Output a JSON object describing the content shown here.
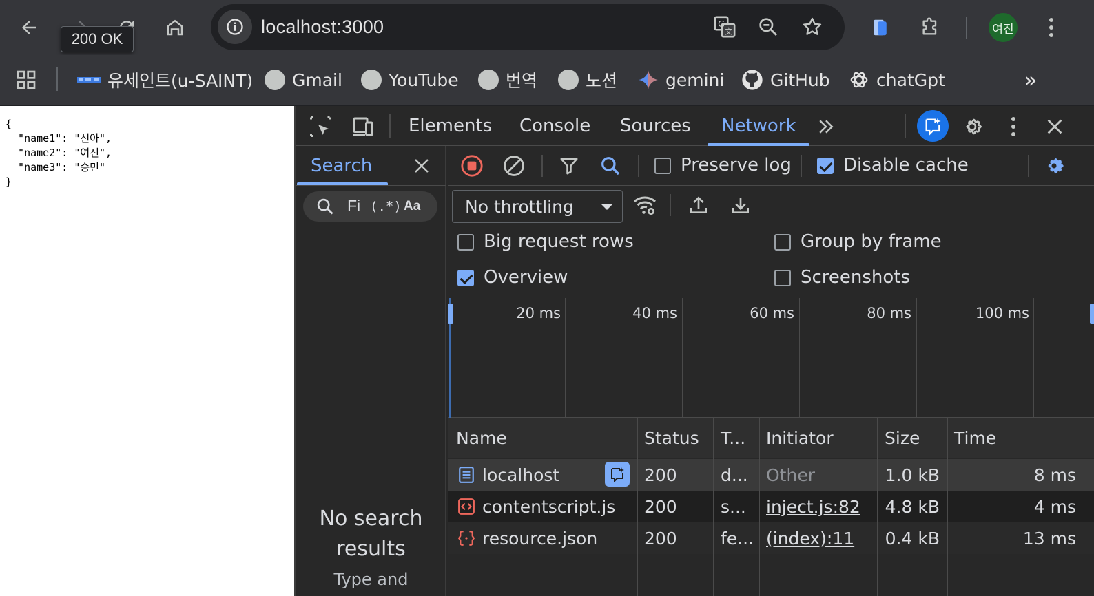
{
  "browser": {
    "url": "localhost:3000",
    "tooltip": "200 OK",
    "avatar_text": "여진",
    "icons": [
      "back-icon",
      "forward-icon",
      "reload-icon",
      "home-icon",
      "site-info-icon",
      "translate-icon",
      "zoom-icon",
      "bookmark-star-icon",
      "extension-icon",
      "puzzle-icon",
      "menu-icon"
    ]
  },
  "bookmarks": {
    "items": [
      {
        "label": "유세인트(u-SAINT)",
        "icon": "usaint-icon"
      },
      {
        "label": "Gmail",
        "icon": "globe-icon"
      },
      {
        "label": "YouTube",
        "icon": "globe-icon"
      },
      {
        "label": "번역",
        "icon": "globe-icon"
      },
      {
        "label": "노션",
        "icon": "globe-icon"
      },
      {
        "label": "gemini",
        "icon": "gemini-icon"
      },
      {
        "label": "GitHub",
        "icon": "github-icon"
      },
      {
        "label": "chatGpt",
        "icon": "chatgpt-icon"
      }
    ],
    "more": "»"
  },
  "page": {
    "json_text": "{\n  \"name1\": \"선아\",\n  \"name2\": \"여진\",\n  \"name3\": \"승민\"\n}"
  },
  "devtools": {
    "tabs": [
      "Elements",
      "Console",
      "Sources",
      "Network"
    ],
    "active_tab": "Network",
    "search": {
      "title": "Search",
      "input_text": "Fi",
      "regex_label": "(.*)",
      "case_label": "Aa",
      "empty_title": "No search results",
      "empty_hint": "Type and"
    },
    "network": {
      "preserve_log": {
        "label": "Preserve log",
        "checked": false
      },
      "disable_cache": {
        "label": "Disable cache",
        "checked": true
      },
      "throttling": "No throttling",
      "big_request_rows": {
        "label": "Big request rows",
        "checked": false
      },
      "group_by_frame": {
        "label": "Group by frame",
        "checked": false
      },
      "overview": {
        "label": "Overview",
        "checked": true
      },
      "screenshots": {
        "label": "Screenshots",
        "checked": false
      },
      "timeline_labels": [
        "20 ms",
        "40 ms",
        "60 ms",
        "80 ms",
        "100 ms"
      ],
      "columns": [
        "Name",
        "Status",
        "T...",
        "Initiator",
        "Size",
        "Time"
      ],
      "rows": [
        {
          "name": "localhost",
          "status": "200",
          "type": "d...",
          "initiator": "Other",
          "size": "1.0 kB",
          "time": "8 ms",
          "icon": "document-icon"
        },
        {
          "name": "contentscript.js",
          "status": "200",
          "type": "s...",
          "initiator": "inject.js:82",
          "size": "4.8 kB",
          "time": "4 ms",
          "icon": "script-icon"
        },
        {
          "name": "resource.json",
          "status": "200",
          "type": "fe...",
          "initiator": "(index):11",
          "size": "0.4 kB",
          "time": "13 ms",
          "icon": "fetch-icon"
        }
      ]
    }
  },
  "colors": {
    "accent": "#7cacf8",
    "toolbar_bg": "#35363a",
    "devtools_bg": "#282828",
    "record_red": "#ee675c",
    "avatar_green": "#1e6a2c"
  }
}
